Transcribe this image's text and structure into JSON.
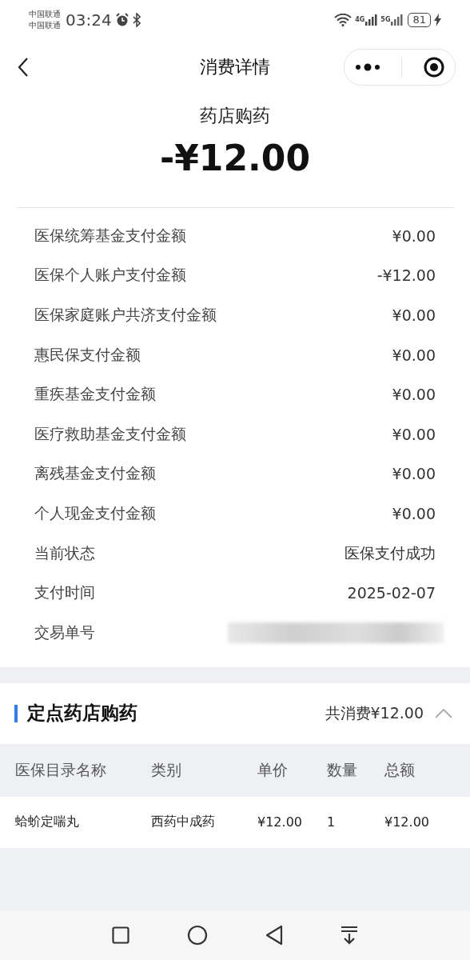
{
  "status_bar": {
    "carriers": [
      "中国联通",
      "中国联通"
    ],
    "time": "03:24",
    "network_4g": "4G",
    "network_5g": "5G",
    "battery": "81"
  },
  "nav": {
    "title": "消费详情"
  },
  "summary": {
    "category": "药店购药",
    "amount": "-¥12.00"
  },
  "details": [
    {
      "label": "医保统筹基金支付金额",
      "value": "¥0.00"
    },
    {
      "label": "医保个人账户支付金额",
      "value": "-¥12.00"
    },
    {
      "label": "医保家庭账户共济支付金额",
      "value": "¥0.00"
    },
    {
      "label": "惠民保支付金额",
      "value": "¥0.00"
    },
    {
      "label": "重疾基金支付金额",
      "value": "¥0.00"
    },
    {
      "label": "医疗救助基金支付金额",
      "value": "¥0.00"
    },
    {
      "label": "离残基金支付金额",
      "value": "¥0.00"
    },
    {
      "label": "个人现金支付金额",
      "value": "¥0.00"
    },
    {
      "label": "当前状态",
      "value": "医保支付成功"
    },
    {
      "label": "支付时间",
      "value": "2025-02-07"
    },
    {
      "label": "交易单号",
      "kind": "redacted"
    }
  ],
  "section": {
    "title": "定点药店购药",
    "total": "共消费¥12.00",
    "expanded": true
  },
  "table": {
    "columns": [
      "医保目录名称",
      "类别",
      "单价",
      "数量",
      "总额"
    ],
    "rows": [
      [
        "蛤蚧定喘丸",
        "西药中成药",
        "¥12.00",
        "1",
        "¥12.00"
      ]
    ]
  }
}
